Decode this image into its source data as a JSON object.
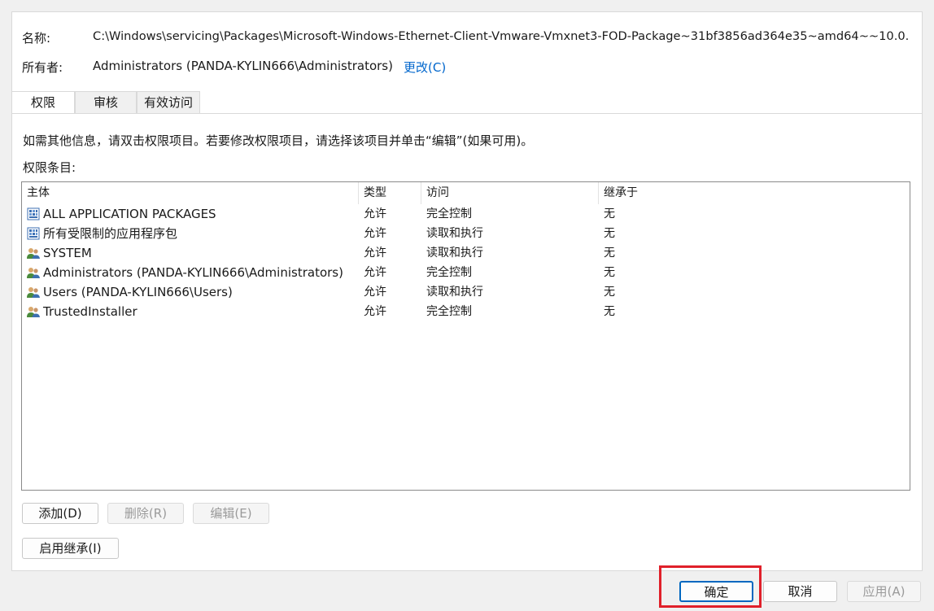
{
  "fields": {
    "name_label": "名称:",
    "name_value": "C:\\Windows\\servicing\\Packages\\Microsoft-Windows-Ethernet-Client-Vmware-Vmxnet3-FOD-Package~31bf3856ad364e35~amd64~~10.0.",
    "owner_label": "所有者:",
    "owner_value": "Administrators (PANDA-KYLIN666\\Administrators)",
    "owner_change": "更改(C)"
  },
  "tabs": [
    {
      "label": "权限",
      "active": true
    },
    {
      "label": "审核",
      "active": false
    },
    {
      "label": "有效访问",
      "active": false
    }
  ],
  "info_text": "如需其他信息，请双击权限项目。若要修改权限项目，请选择该项目并单击“编辑”(如果可用)。",
  "entries_label": "权限条目:",
  "columns": [
    "主体",
    "类型",
    "访问",
    "继承于"
  ],
  "rows": [
    {
      "icon": "app-package-icon",
      "principal": "ALL APPLICATION PACKAGES",
      "type": "允许",
      "access": "完全控制",
      "inherited": "无"
    },
    {
      "icon": "app-package-icon",
      "principal": "所有受限制的应用程序包",
      "type": "允许",
      "access": "读取和执行",
      "inherited": "无"
    },
    {
      "icon": "users-group-icon",
      "principal": "SYSTEM",
      "type": "允许",
      "access": "读取和执行",
      "inherited": "无"
    },
    {
      "icon": "users-group-icon",
      "principal": "Administrators (PANDA-KYLIN666\\Administrators)",
      "type": "允许",
      "access": "完全控制",
      "inherited": "无"
    },
    {
      "icon": "users-group-icon",
      "principal": "Users (PANDA-KYLIN666\\Users)",
      "type": "允许",
      "access": "读取和执行",
      "inherited": "无"
    },
    {
      "icon": "users-group-icon",
      "principal": "TrustedInstaller",
      "type": "允许",
      "access": "完全控制",
      "inherited": "无"
    }
  ],
  "buttons": {
    "add": "添加(D)",
    "remove": "删除(R)",
    "edit": "编辑(E)",
    "enable_inheritance": "启用继承(I)",
    "ok": "确定",
    "cancel": "取消",
    "apply": "应用(A)"
  },
  "colors": {
    "link": "#0066cc",
    "highlight": "#e0202a",
    "primary_border": "#0067c0"
  }
}
